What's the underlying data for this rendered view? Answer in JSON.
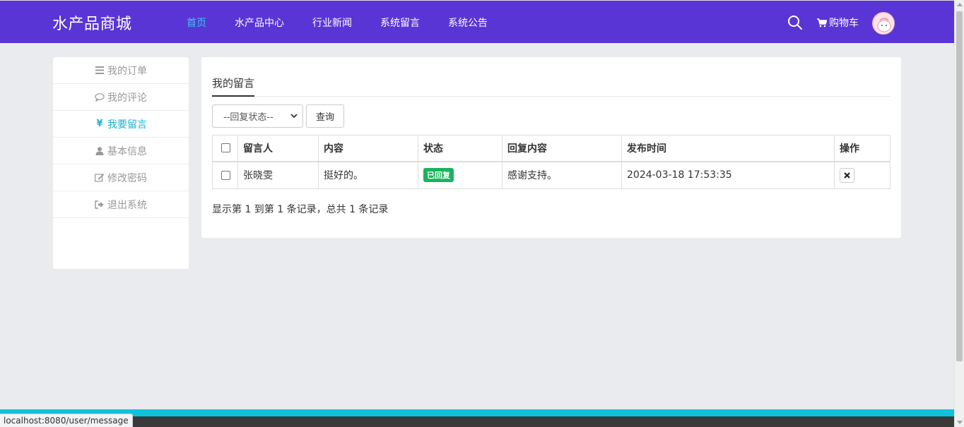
{
  "header": {
    "brand": "水产品商城",
    "nav": [
      {
        "label": "首页",
        "active": true
      },
      {
        "label": "水产品中心",
        "active": false
      },
      {
        "label": "行业新闻",
        "active": false
      },
      {
        "label": "系统留言",
        "active": false
      },
      {
        "label": "系统公告",
        "active": false
      }
    ],
    "cart_label": "购物车",
    "accent_color": "#5a35d6",
    "active_color": "#38c8f0"
  },
  "sidebar": {
    "items": [
      {
        "label": "我的订单",
        "icon": "list-icon",
        "active": false
      },
      {
        "label": "我的评论",
        "icon": "comment-icon",
        "active": false
      },
      {
        "label": "我要留言",
        "icon": "yen-icon",
        "active": true
      },
      {
        "label": "基本信息",
        "icon": "user-icon",
        "active": false
      },
      {
        "label": "修改密码",
        "icon": "edit-icon",
        "active": false
      },
      {
        "label": "退出系统",
        "icon": "sign-out-icon",
        "active": false
      }
    ]
  },
  "main": {
    "tab": "我的留言",
    "filter": {
      "selected": "--回复状态--"
    },
    "query_label": "查询",
    "table": {
      "columns": [
        "留言人",
        "内容",
        "状态",
        "回复内容",
        "发布时间",
        "操作"
      ],
      "rows": [
        {
          "author": "张晓雯",
          "content": "挺好的。",
          "status": "已回复",
          "reply": "感谢支持。",
          "time": "2024-03-18 17:53:35"
        }
      ]
    },
    "pagination_info": "显示第 1 到第 1 条记录，总共 1 条记录"
  },
  "status_bar": {
    "url": "localhost:8080/user/message"
  }
}
